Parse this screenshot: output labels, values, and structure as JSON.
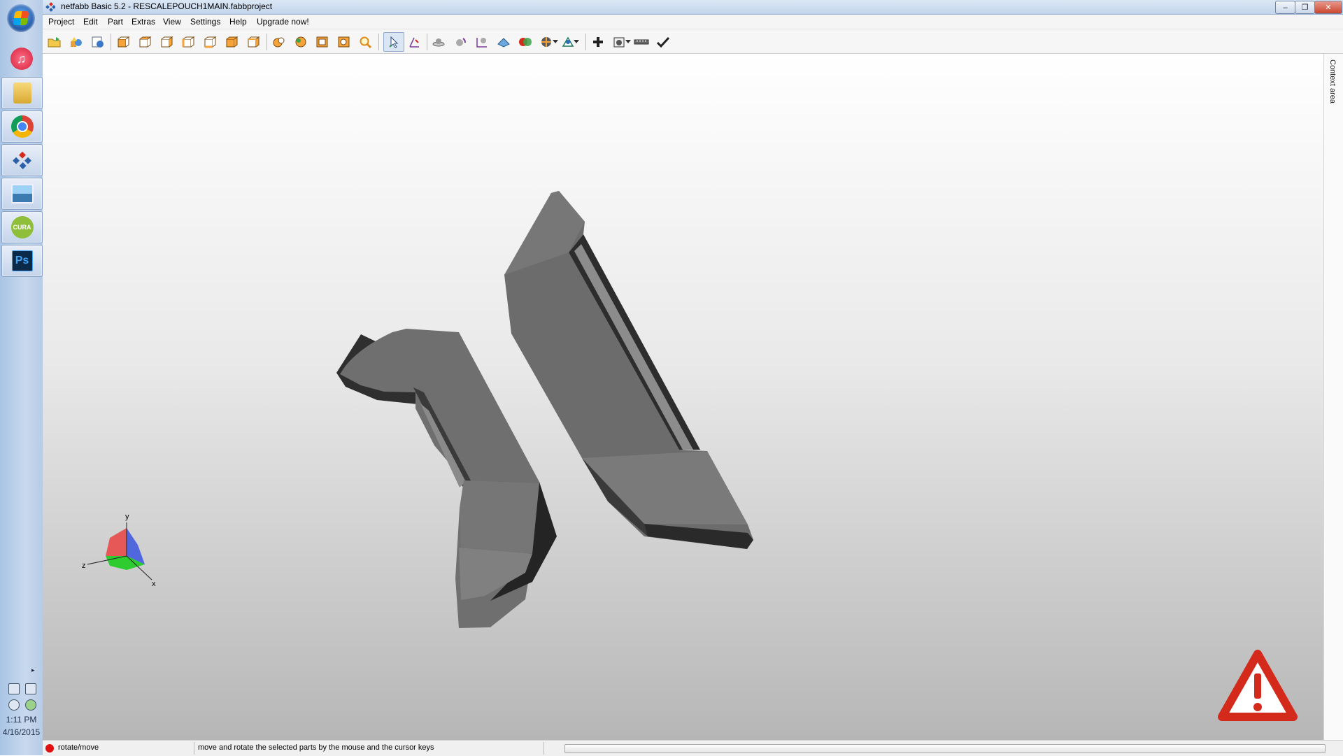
{
  "window": {
    "title": "netfabb Basic 5.2 - RESCALEPOUCH1MAIN.fabbproject",
    "controls": {
      "minimize": "–",
      "restore": "❐",
      "close": "✕"
    }
  },
  "menu": [
    "Project",
    "Edit",
    "Part",
    "Extras",
    "View",
    "Settings",
    "Help",
    "Upgrade now!"
  ],
  "taskbar": {
    "apps": [
      {
        "name": "itunes-icon",
        "glyph": "♫",
        "color": "#e8364a"
      },
      {
        "name": "file-explorer-icon",
        "glyph": "",
        "color": "#e9c45a",
        "active": true
      },
      {
        "name": "chrome-icon",
        "glyph": "",
        "color": "#4285f4"
      },
      {
        "name": "netfabb-icon",
        "glyph": "",
        "color": "#2b5fa8"
      },
      {
        "name": "photo-viewer-icon",
        "glyph": "",
        "color": "#3f7fb8"
      },
      {
        "name": "cura-icon",
        "glyph": "CURA",
        "color": "#8fbf3a"
      },
      {
        "name": "photoshop-icon",
        "glyph": "Ps",
        "color": "#0b2a4a"
      }
    ],
    "clock_time": "1:11 PM",
    "clock_date": "4/16/2015"
  },
  "context_area": {
    "label": "Context area"
  },
  "axes": {
    "x": "x",
    "y": "y",
    "z": "z"
  },
  "statusbar": {
    "mode": "rotate/move",
    "hint": "move and rotate the selected parts by the mouse and the cursor keys"
  },
  "colors": {
    "accent": "#2b5fa8",
    "warning": "#d42a1c",
    "part": "#6e6e6e"
  }
}
